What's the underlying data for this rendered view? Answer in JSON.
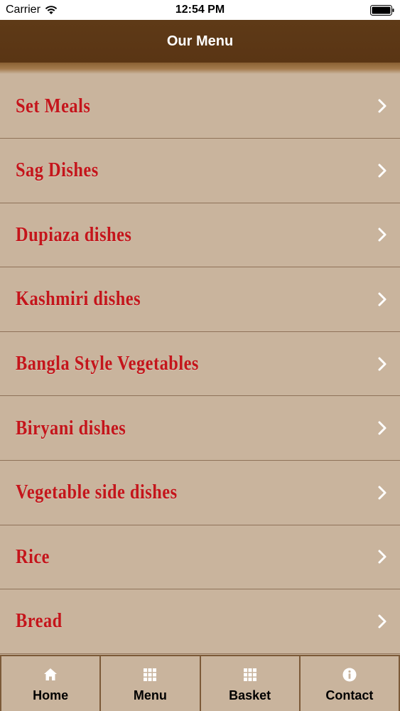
{
  "status_bar": {
    "carrier": "Carrier",
    "time": "12:54 PM",
    "wifi_icon": "wifi-icon",
    "battery_icon": "battery-icon"
  },
  "header": {
    "title": "Our Menu"
  },
  "colors": {
    "header_bg": "#5a3514",
    "list_bg": "#c9b49d",
    "item_text": "#c4151b",
    "divider": "#8f7259"
  },
  "menu": {
    "items": [
      {
        "label": "Set Meals",
        "icon": "chevron-right-icon"
      },
      {
        "label": "Sag Dishes",
        "icon": "chevron-right-icon"
      },
      {
        "label": "Dupiaza dishes",
        "icon": "chevron-right-icon"
      },
      {
        "label": "Kashmiri dishes",
        "icon": "chevron-right-icon"
      },
      {
        "label": "Bangla Style Vegetables",
        "icon": "chevron-right-icon"
      },
      {
        "label": "Biryani dishes",
        "icon": "chevron-right-icon"
      },
      {
        "label": "Vegetable side dishes",
        "icon": "chevron-right-icon"
      },
      {
        "label": "Rice",
        "icon": "chevron-right-icon"
      },
      {
        "label": "Bread",
        "icon": "chevron-right-icon"
      }
    ]
  },
  "tab_bar": {
    "tabs": [
      {
        "label": "Home",
        "icon": "home-icon"
      },
      {
        "label": "Menu",
        "icon": "grid-icon"
      },
      {
        "label": "Basket",
        "icon": "grid-icon"
      },
      {
        "label": "Contact",
        "icon": "info-icon"
      }
    ]
  }
}
